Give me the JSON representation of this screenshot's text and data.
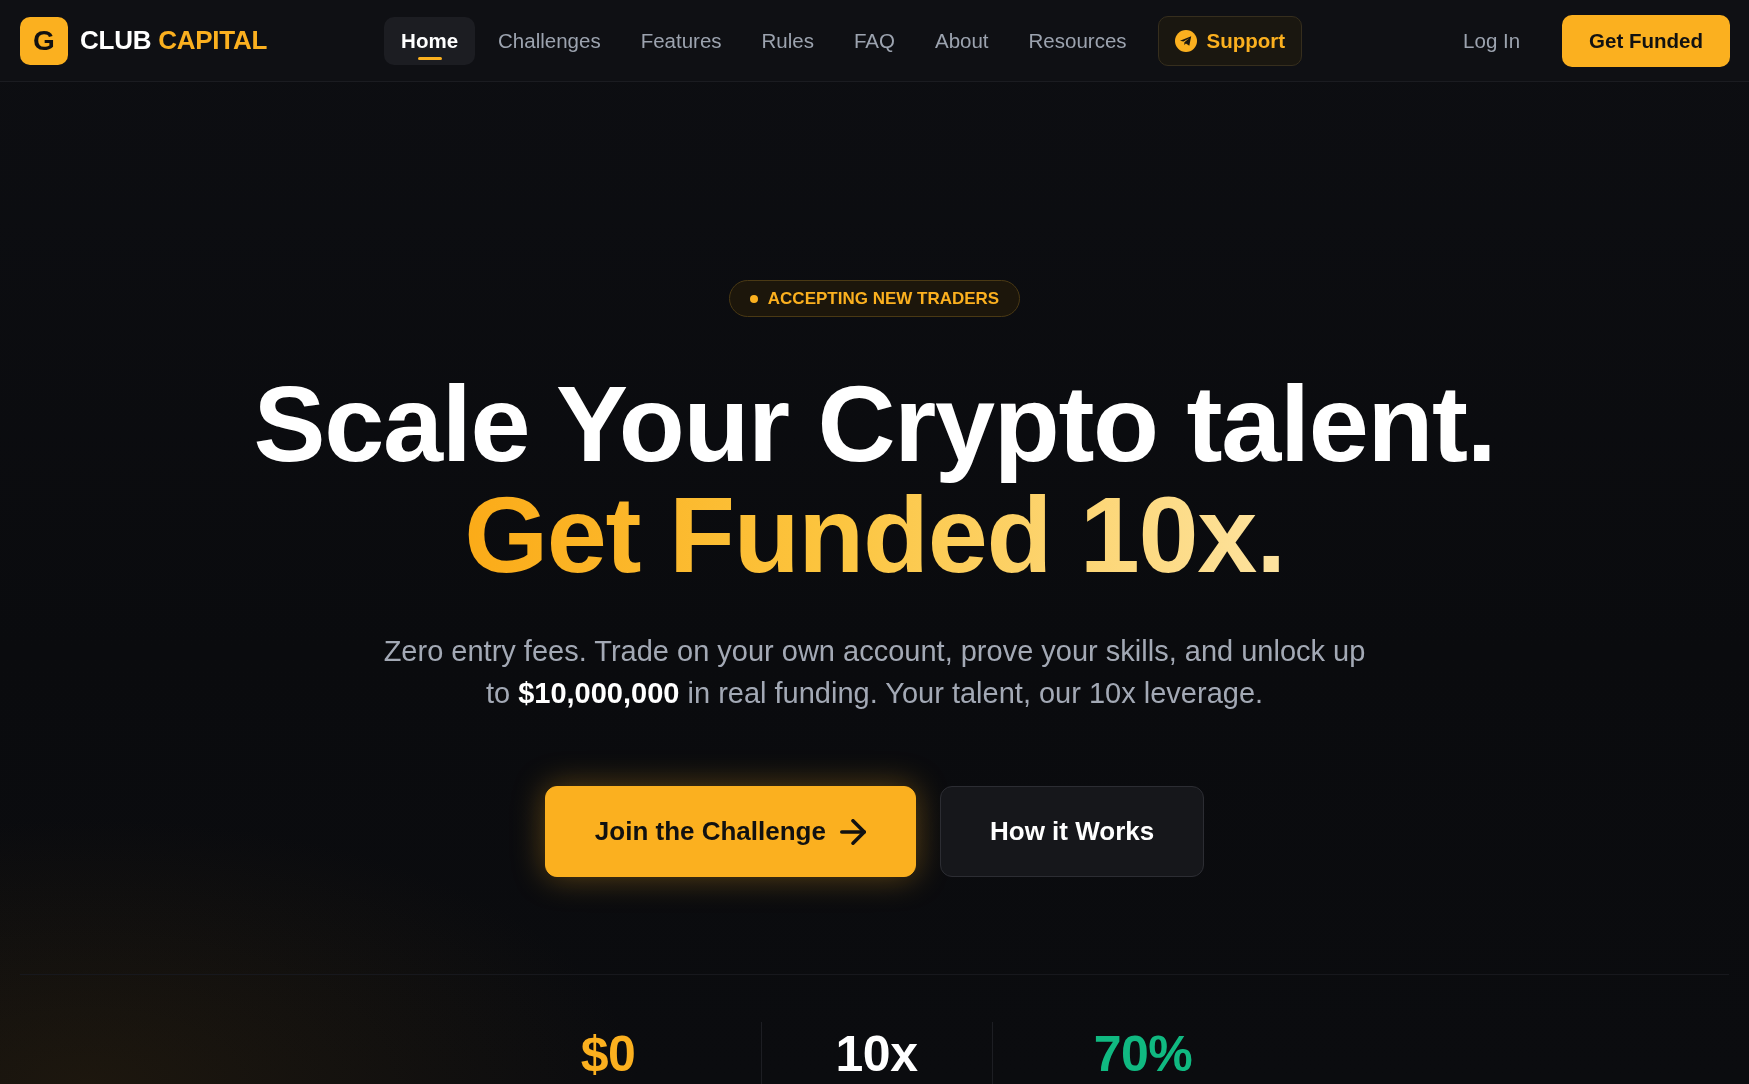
{
  "brand": {
    "mark": "G",
    "name": "CLUB",
    "name_accent": "CAPITAL"
  },
  "nav": {
    "items": [
      {
        "label": "Home",
        "selected": true
      },
      {
        "label": "Challenges",
        "selected": false
      },
      {
        "label": "Features",
        "selected": false
      },
      {
        "label": "Rules",
        "selected": false
      },
      {
        "label": "FAQ",
        "selected": false
      },
      {
        "label": "About",
        "selected": false
      },
      {
        "label": "Resources",
        "selected": false
      }
    ],
    "support": "Support",
    "login": "Log In",
    "cta": "Get Funded"
  },
  "hero": {
    "badge": "ACCEPTING NEW TRADERS",
    "headline": "Scale Your Crypto talent.",
    "headline_accent": "Get Funded 10x.",
    "subtitle": "Zero entry fees. Trade on your own account, prove your skills, and unlock up to **$10,000,000** in real funding. Your talent, our 10x leverage.",
    "buttons": [
      {
        "kind": "primary",
        "label": "Join the Challenge"
      },
      {
        "kind": "secondary",
        "label": "How it Works"
      }
    ]
  },
  "stats": [
    {
      "value": "$0",
      "color": "#fbb01f"
    },
    {
      "value": "10x",
      "color": "#ffffff"
    },
    {
      "value": "70%",
      "color": "#10b981"
    }
  ]
}
